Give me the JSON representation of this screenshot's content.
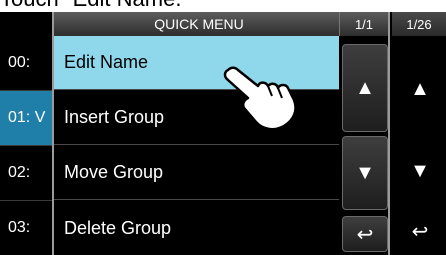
{
  "caption": "Touch \"Edit Name.\"",
  "background_list": [
    {
      "label": "00:"
    },
    {
      "label": "01: V"
    },
    {
      "label": "02:"
    },
    {
      "label": "03:"
    }
  ],
  "background_header": {
    "page": "1/26"
  },
  "popup": {
    "title": "QUICK MENU",
    "page": "1/1",
    "items": [
      {
        "label": "Edit Name"
      },
      {
        "label": "Insert Group"
      },
      {
        "label": "Move Group"
      },
      {
        "label": "Delete Group"
      }
    ],
    "up_symbol": "▲",
    "down_symbol": "▼",
    "back_symbol": "↩"
  },
  "background_buttons": {
    "up_symbol": "▲",
    "down_symbol": "▼",
    "back_symbol": "↩"
  },
  "colors": {
    "highlight": "#8fd8ec",
    "selected_row": "#1f7fa8"
  },
  "icons": {
    "pointer": "hand-pointer-icon"
  }
}
